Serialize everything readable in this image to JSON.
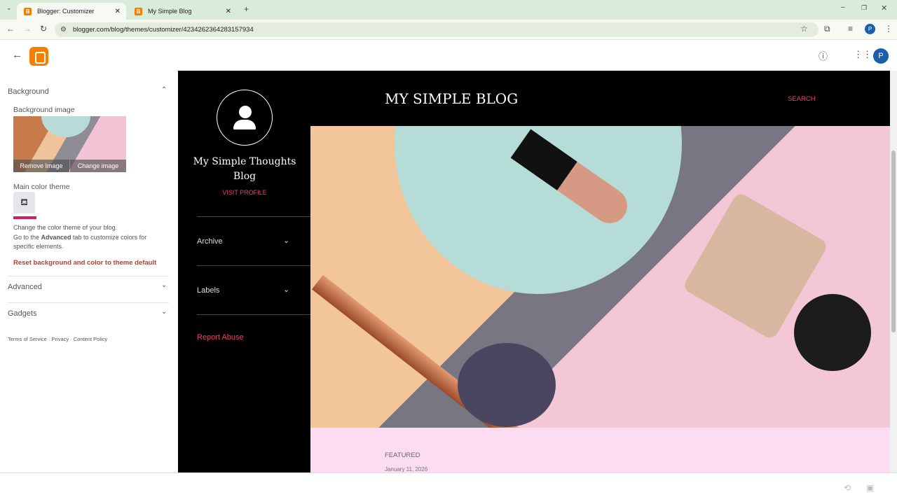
{
  "browser": {
    "tabs": [
      {
        "label": "Blogger: Customizer",
        "active": true
      },
      {
        "label": "My Simple Blog",
        "active": false
      }
    ],
    "url": "blogger.com/blog/themes/customizer/4234262364283157934",
    "profile_initial": "P"
  },
  "app": {
    "avatar_initial": "P"
  },
  "sidebar": {
    "background_label": "Background",
    "bg_image_label": "Background image",
    "remove_image": "Remove Image",
    "change_image": "Change image",
    "main_color_label": "Main color theme",
    "desc1": "Change the color theme of your blog.",
    "desc2_pre": "Go to the ",
    "desc2_bold": "Advanced",
    "desc2_post": " tab to customize colors for specific elements.",
    "reset": "Reset background and color to theme default",
    "advanced": "Advanced",
    "gadgets": "Gadgets",
    "footer": [
      "Terms of Service",
      "Privacy",
      "Content Policy"
    ]
  },
  "preview": {
    "blog_title": "MY SIMPLE BLOG",
    "search": "SEARCH",
    "profile_name": "My Simple Thoughts Blog",
    "visit_profile": "VISIT PROFILE",
    "archive": "Archive",
    "labels": "Labels",
    "report_abuse": "Report Abuse",
    "featured": "FEATURED",
    "date": "January 11, 2026"
  },
  "colors": {
    "accent": "#e9436d",
    "blogger": "#f57d00",
    "reset": "#c0392b"
  }
}
